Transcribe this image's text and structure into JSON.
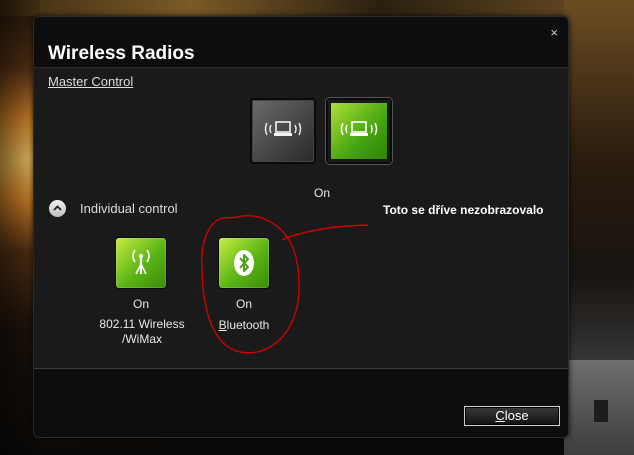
{
  "window": {
    "title": "Wireless Radios",
    "close_glyph": "×"
  },
  "master": {
    "label": "Master Control",
    "state": "On",
    "off_icon": "laptop-wireless-icon",
    "on_icon": "laptop-wireless-icon"
  },
  "individual": {
    "label": "Individual control",
    "radios": [
      {
        "state": "On",
        "name_line1": "802.11 Wireless",
        "name_line2": "/WiMax",
        "icon": "antenna-icon"
      },
      {
        "state": "On",
        "name": "Bluetooth",
        "icon": "bluetooth-icon"
      }
    ]
  },
  "footer": {
    "close_label": "Close"
  },
  "annotation": {
    "text": "Toto se dříve nezobrazovalo",
    "color": "#d00000"
  }
}
